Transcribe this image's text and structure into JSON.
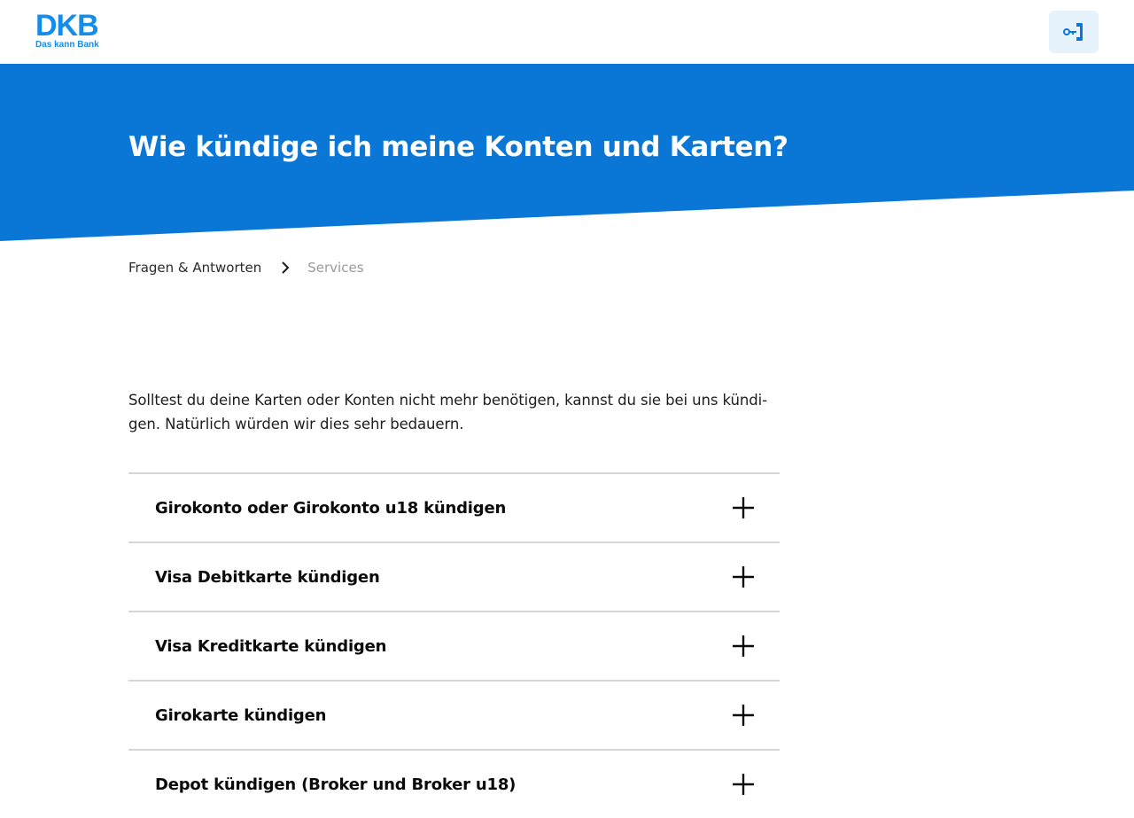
{
  "header": {
    "logo_text": "DKB",
    "logo_tagline": "Das kann Bank",
    "login_icon": "key-icon"
  },
  "hero": {
    "title": "Wie kündige ich meine Konten und Karten?"
  },
  "breadcrumb": {
    "items": [
      {
        "label": "Fragen & Antworten"
      },
      {
        "label": "Services"
      }
    ]
  },
  "intro": {
    "text": "Solltest du deine Karten oder Konten nicht mehr benötigen, kannst du sie bei uns kündi­gen. Natürlich würden wir dies sehr bedauern."
  },
  "accordion": {
    "items": [
      {
        "label": "Girokonto oder Girokonto u18 kündigen"
      },
      {
        "label": "Visa Debitkarte kündigen"
      },
      {
        "label": "Visa Kreditkarte kündigen"
      },
      {
        "label": "Girokarte kündigen"
      },
      {
        "label": "Depot kündigen (Broker und Broker u18)"
      }
    ]
  },
  "colors": {
    "brand_blue": "#0a77d6",
    "logo_blue": "#148dea",
    "login_bg": "#e6f2fc",
    "divider": "#d6d6d6"
  }
}
